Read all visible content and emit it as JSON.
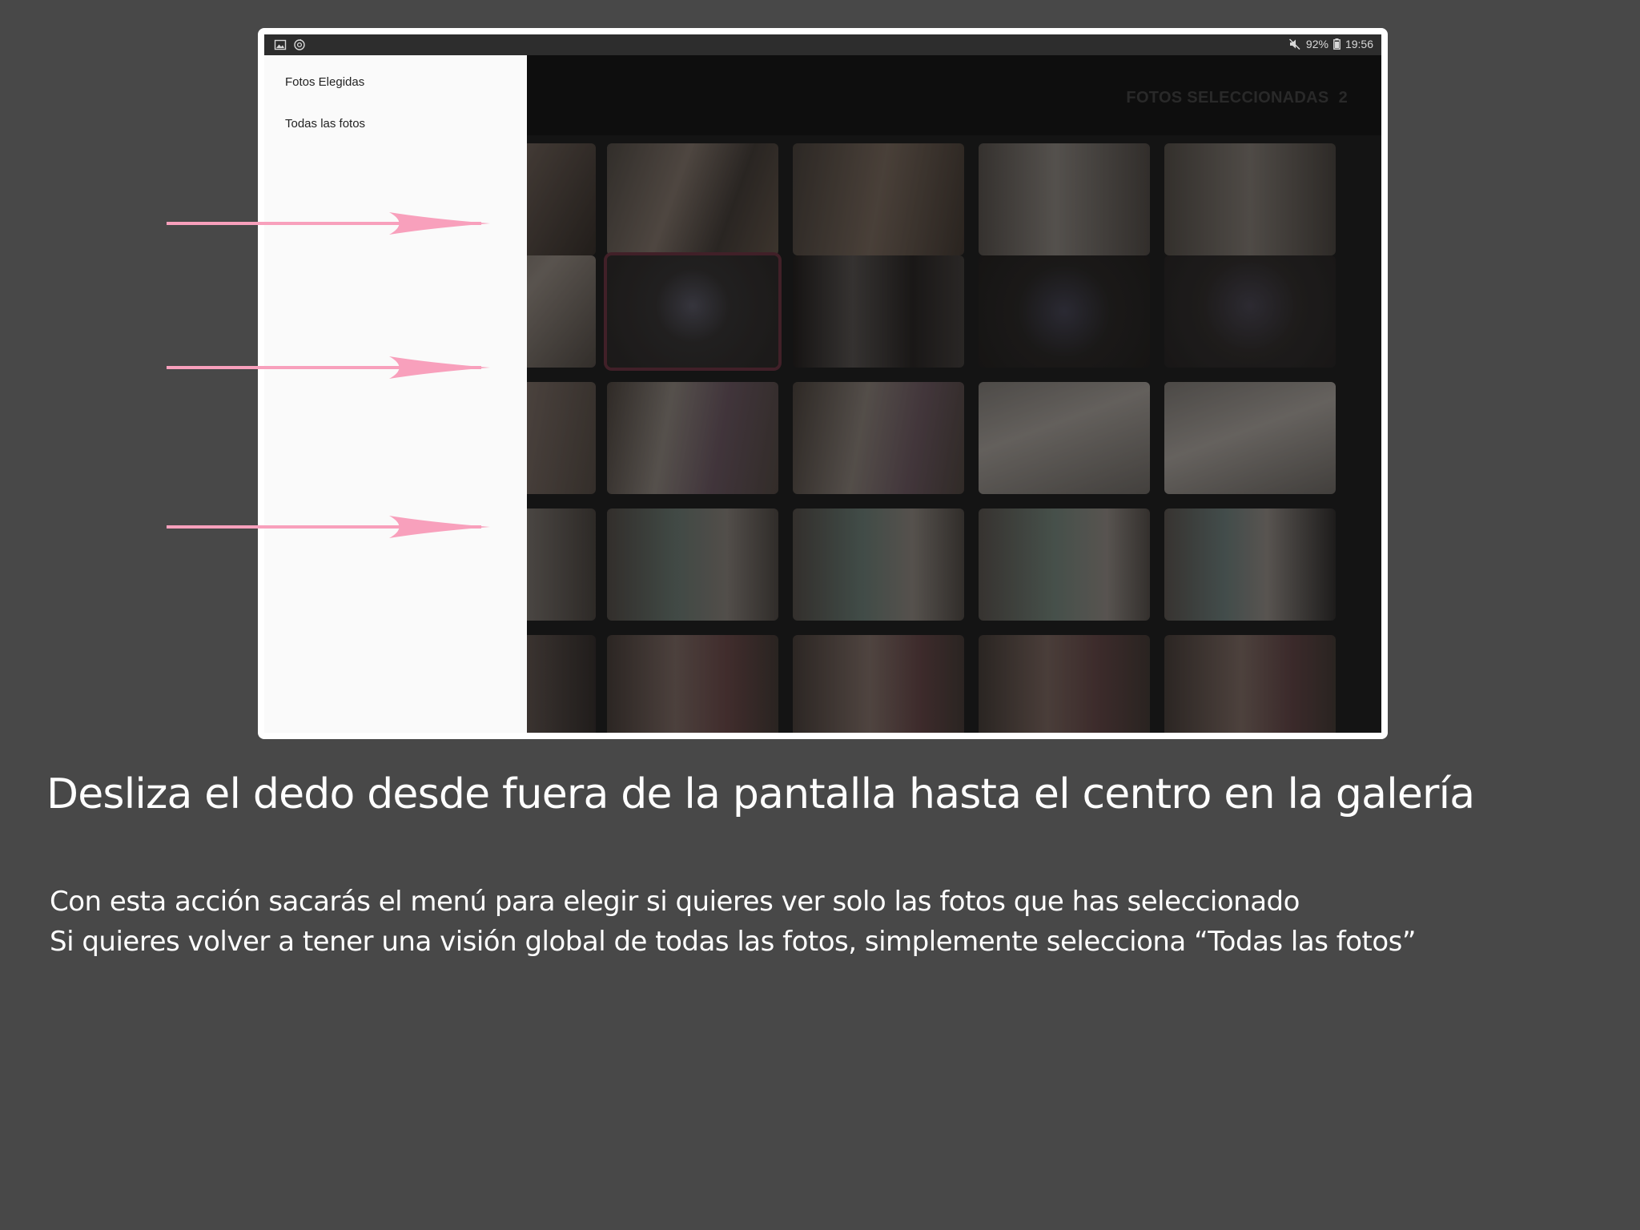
{
  "status_bar": {
    "battery": "92%",
    "time": "19:56",
    "icons": [
      "image-icon",
      "sync-icon",
      "mute-icon",
      "battery-icon"
    ]
  },
  "app_bar": {
    "title": "FOTOS SELECCIONADAS",
    "count": "2"
  },
  "drawer": {
    "items": [
      {
        "label": "Fotos Elegidas"
      },
      {
        "label": "Todas las fotos"
      }
    ]
  },
  "gallery": {
    "selected_count": 2
  },
  "annotation": {
    "arrow_color": "#f8a0bc",
    "arrow_count": 3
  },
  "caption": {
    "headline": "Desliza el dedo desde fuera de la pantalla hasta el centro en la galería",
    "line1": "Con esta acción sacarás el menú para elegir si quieres ver solo las fotos que has seleccionado",
    "line2": "Si quieres volver a tener una visión global de todas las fotos, simplemente selecciona “Todas las fotos”"
  },
  "colors": {
    "background": "#484848",
    "drawer": "#fafafa",
    "selected_outline": "#5a2d38"
  }
}
